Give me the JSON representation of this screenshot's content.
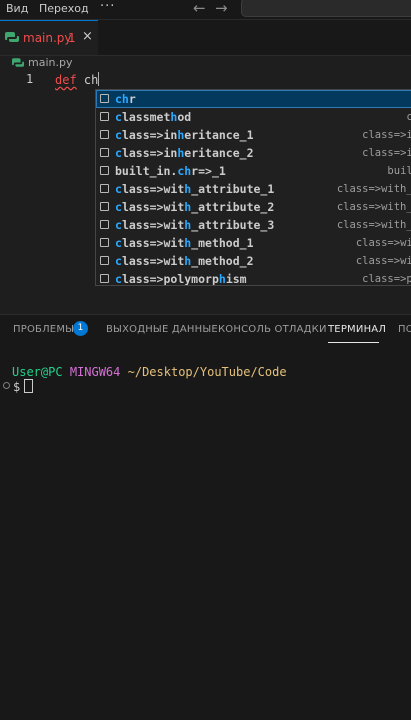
{
  "menu": {
    "view": "Вид",
    "go": "Переход",
    "more": "···"
  },
  "nav": {
    "back": "←",
    "forward": "→"
  },
  "tab": {
    "filename": "main.py",
    "problem_count": "1",
    "close": "×"
  },
  "breadcrumb": {
    "file": "main.py"
  },
  "editor": {
    "line_number": "1",
    "keyword": "def",
    "typed": "ch"
  },
  "suggestions": [
    {
      "pre": "",
      "hl": "ch",
      "post": "r",
      "detail": ""
    },
    {
      "pre": "",
      "hl": "c",
      "post": "lassmet",
      "hl2": "h",
      "post2": "od",
      "detail": "class"
    },
    {
      "pre": "",
      "hl": "c",
      "post": "lass=>in",
      "hl2": "h",
      "post2": "eritance_1",
      "detail": "class=>inher"
    },
    {
      "pre": "",
      "hl": "c",
      "post": "lass=>in",
      "hl2": "h",
      "post2": "eritance_2",
      "detail": "class=>inher"
    },
    {
      "pre": "built_in.",
      "hl": "ch",
      "post": "r=>_1",
      "detail": "built_in"
    },
    {
      "pre": "",
      "hl": "c",
      "post": "lass=>wit",
      "hl2": "h",
      "post2": "_attribute_1",
      "detail": "class=>with_attr"
    },
    {
      "pre": "",
      "hl": "c",
      "post": "lass=>wit",
      "hl2": "h",
      "post2": "_attribute_2",
      "detail": "class=>with_attr"
    },
    {
      "pre": "",
      "hl": "c",
      "post": "lass=>wit",
      "hl2": "h",
      "post2": "_attribute_3",
      "detail": "class=>with_attr"
    },
    {
      "pre": "",
      "hl": "c",
      "post": "lass=>wit",
      "hl2": "h",
      "post2": "_method_1",
      "detail": "class=>with_m"
    },
    {
      "pre": "",
      "hl": "c",
      "post": "lass=>wit",
      "hl2": "h",
      "post2": "_method_2",
      "detail": "class=>with_m"
    },
    {
      "pre": "",
      "hl": "c",
      "post": "lass=>polymorp",
      "hl2": "h",
      "post2": "ism",
      "detail": "class=>polym"
    }
  ],
  "panel": {
    "problems": "ПРОБЛЕМЫ",
    "problems_count": "1",
    "output": "ВЫХОДНЫЕ ДАННЫЕ",
    "debug_console": "КОНСОЛЬ ОТЛАДКИ",
    "terminal": "ТЕРМИНАЛ",
    "ports": "ПО"
  },
  "terminal": {
    "user": "User@PC",
    "host": "MINGW64",
    "path": "~/Desktop/YouTube/Code",
    "prompt": "$"
  },
  "colors": {
    "accent": "#0078d4",
    "error": "#f14c4c",
    "match_highlight": "#2aaaff",
    "terminal_user": "#23d18b",
    "terminal_host": "#d670d6",
    "terminal_path": "#e5c07b"
  }
}
